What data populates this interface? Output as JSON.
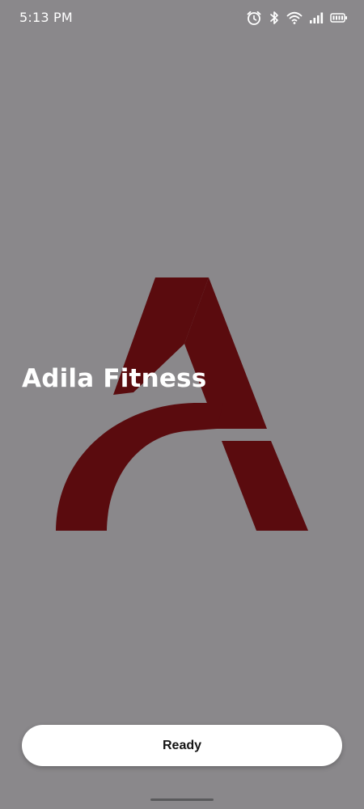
{
  "status_bar": {
    "time": "5:13 PM",
    "icons": [
      "alarm-icon",
      "bluetooth-icon",
      "wifi-icon",
      "signal-icon",
      "battery-icon"
    ]
  },
  "app": {
    "title": "Adila Fitness",
    "logo": "adila-a-logo",
    "logo_color": "#5a0b0e",
    "background_color": "#8a888b"
  },
  "actions": {
    "ready_label": "Ready"
  }
}
